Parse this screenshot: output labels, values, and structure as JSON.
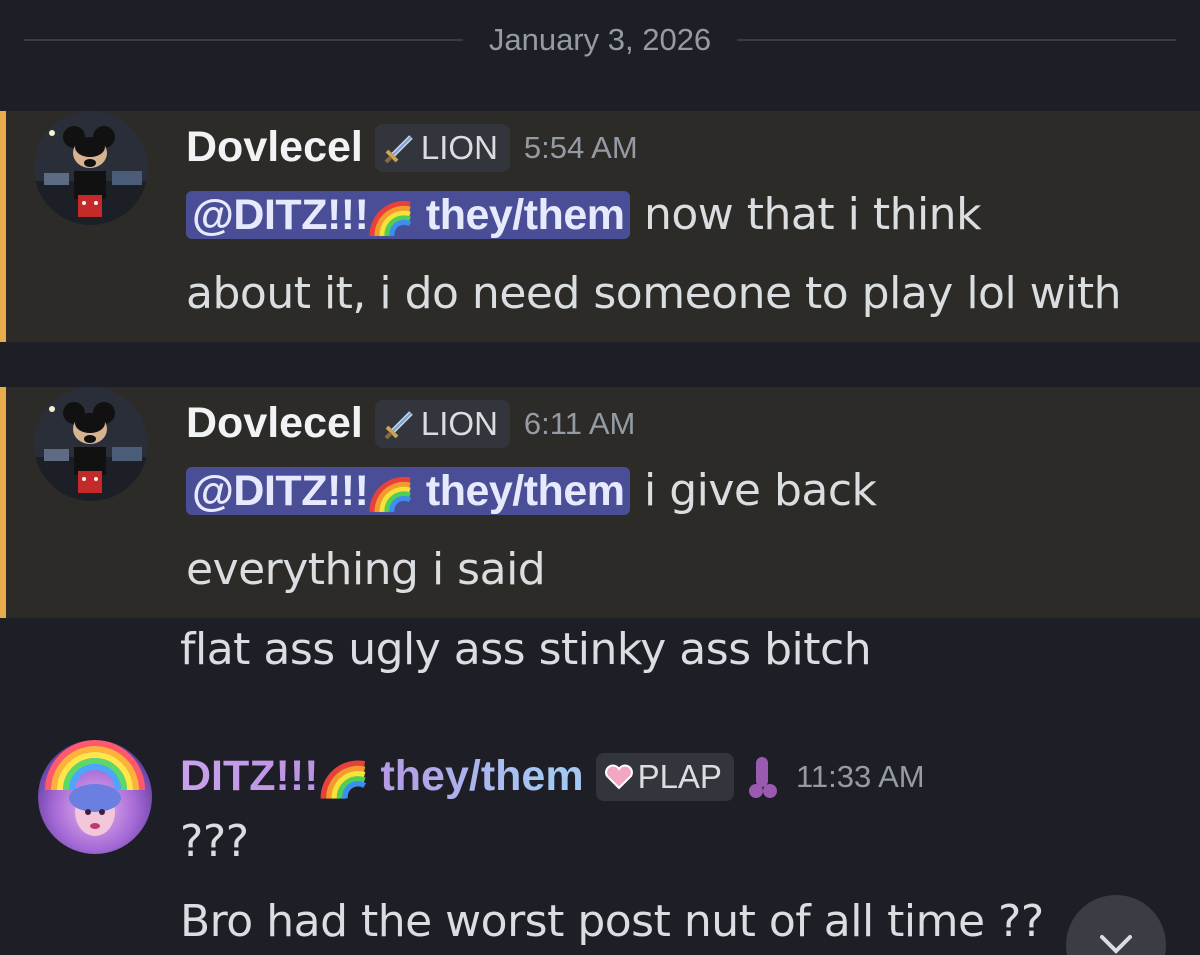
{
  "date_divider": "January 3, 2026",
  "messages": [
    {
      "author": "Dovlecel",
      "role_tag": "LION",
      "time": "5:54 AM",
      "mention": "@DITZ!!!",
      "mention_suffix": "they/them",
      "lines": [
        "now that i think",
        "about it, i do need someone to play lol with"
      ]
    },
    {
      "author": "Dovlecel",
      "role_tag": "LION",
      "time": "6:11 AM",
      "mention": "@DITZ!!!",
      "mention_suffix": "they/them",
      "lines": [
        "i give back",
        "everything i said"
      ]
    },
    {
      "followup": "flat ass ugly ass stinky ass bitch"
    },
    {
      "author": "DITZ!!!",
      "author_suffix": "they/them",
      "role_tag": "PLAP",
      "time": "11:33 AM",
      "lines": [
        "???",
        "Bro had the worst post nut of all time ??"
      ]
    }
  ],
  "icons": {
    "sword": "sword-icon",
    "heart": "pixel-heart-icon",
    "rainbow": "rainbow-emoji",
    "scroll": "chevron-down-icon"
  },
  "colors": {
    "background": "#1e1f26",
    "mention_highlight": "#2d2b27",
    "mention_bar": "#e7ad4a",
    "mention_pill": "#4a4e96"
  }
}
